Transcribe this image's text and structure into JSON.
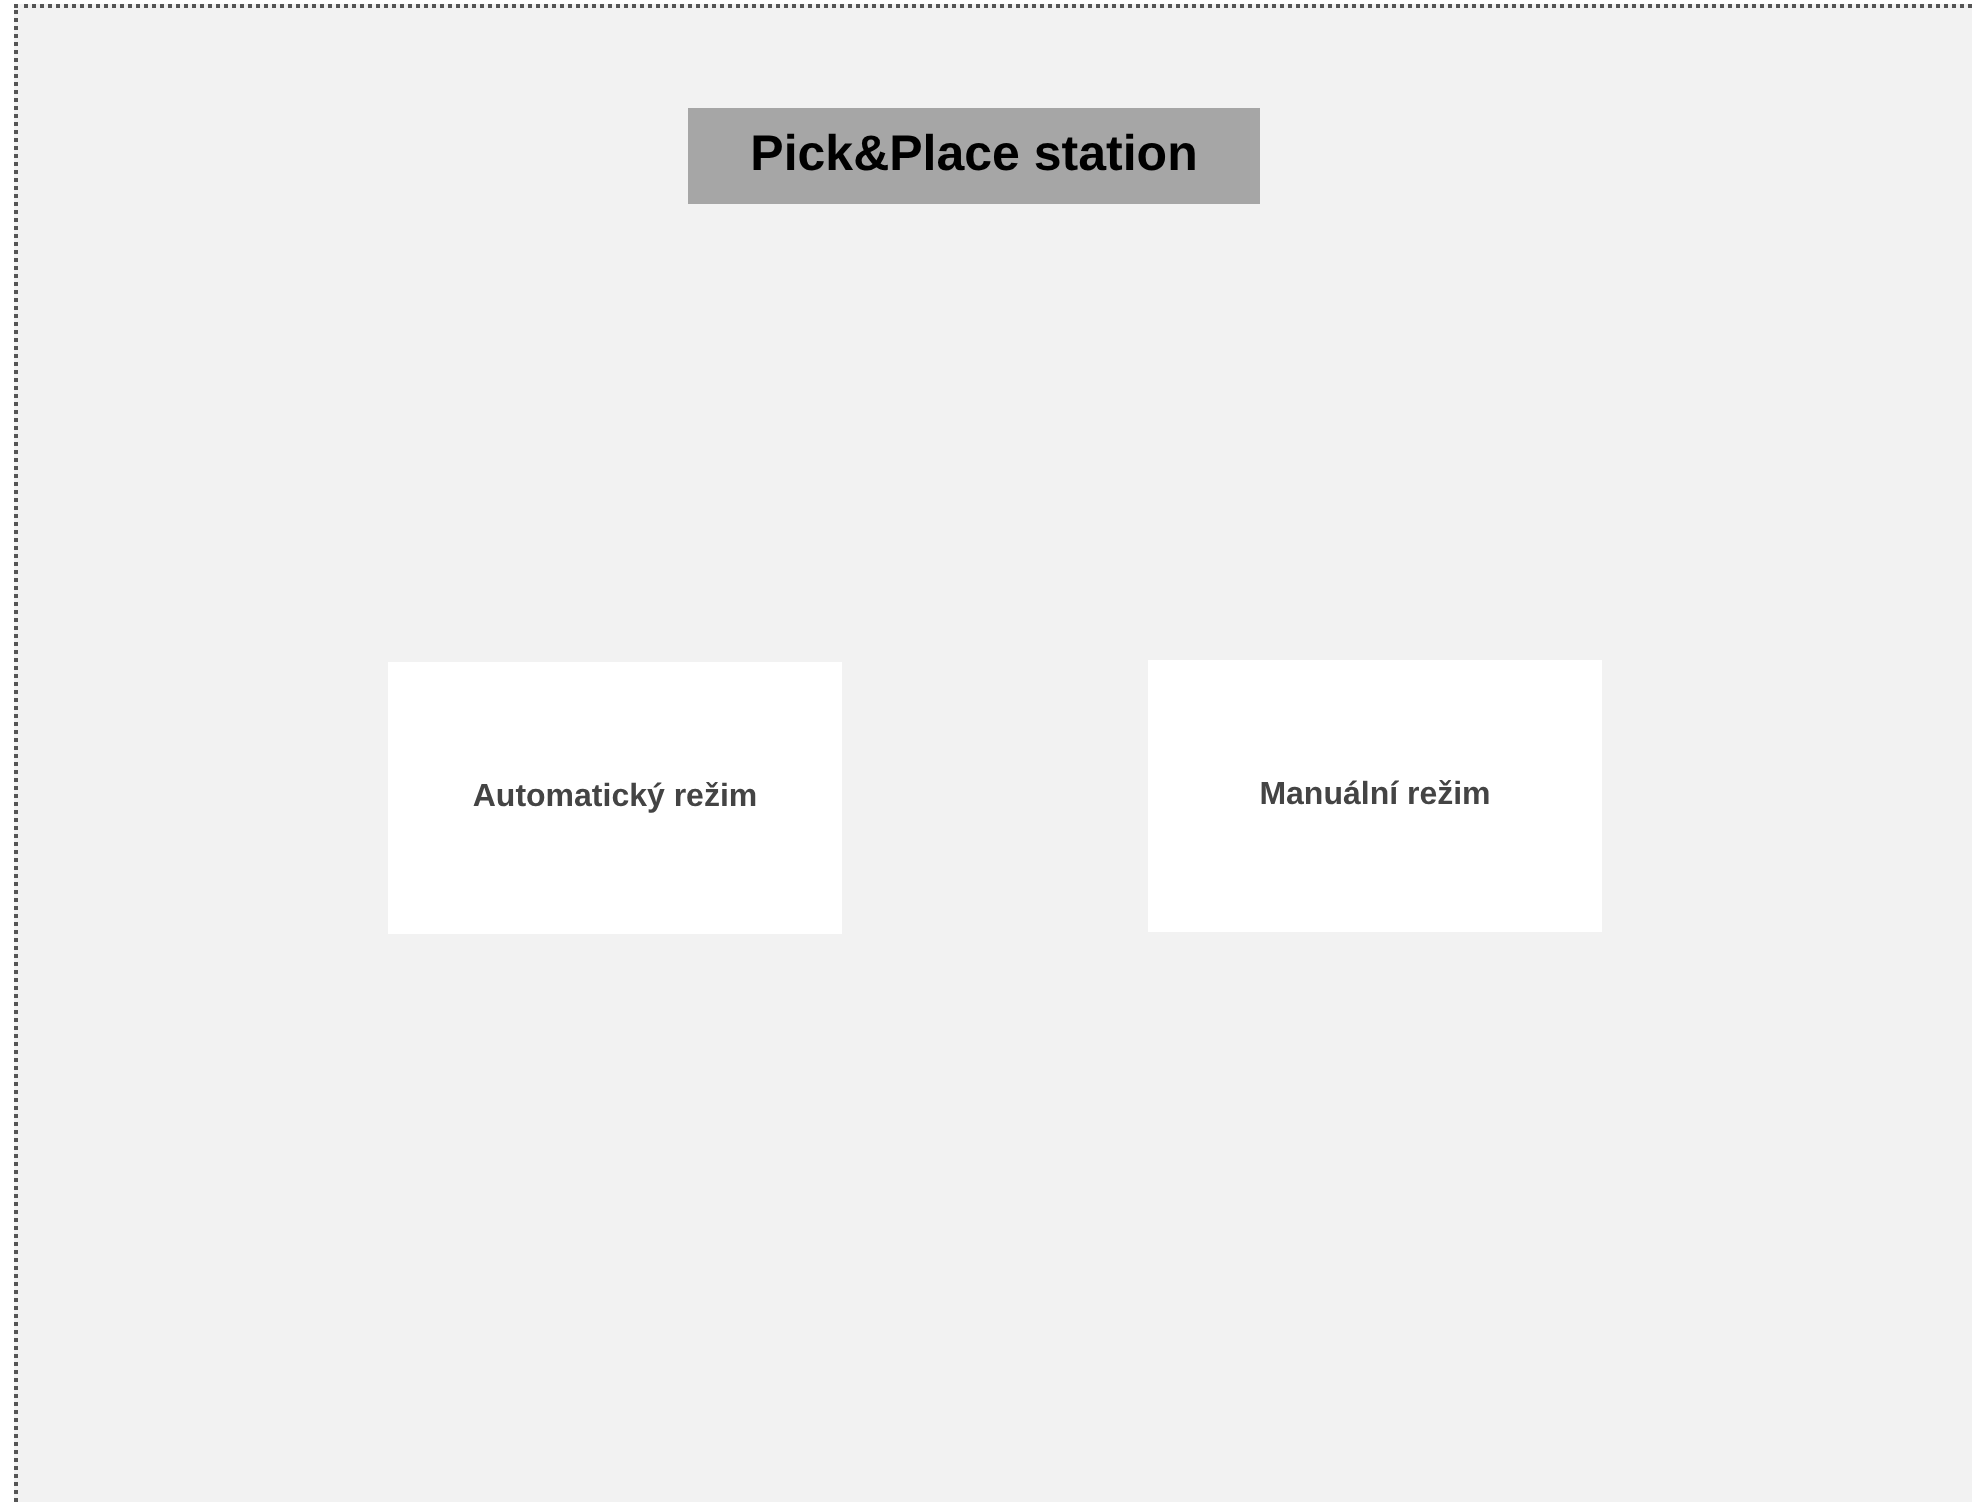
{
  "title": "Pick&Place station",
  "buttons": [
    {
      "label": "Automatický režim"
    },
    {
      "label": "Manuální režim"
    }
  ]
}
